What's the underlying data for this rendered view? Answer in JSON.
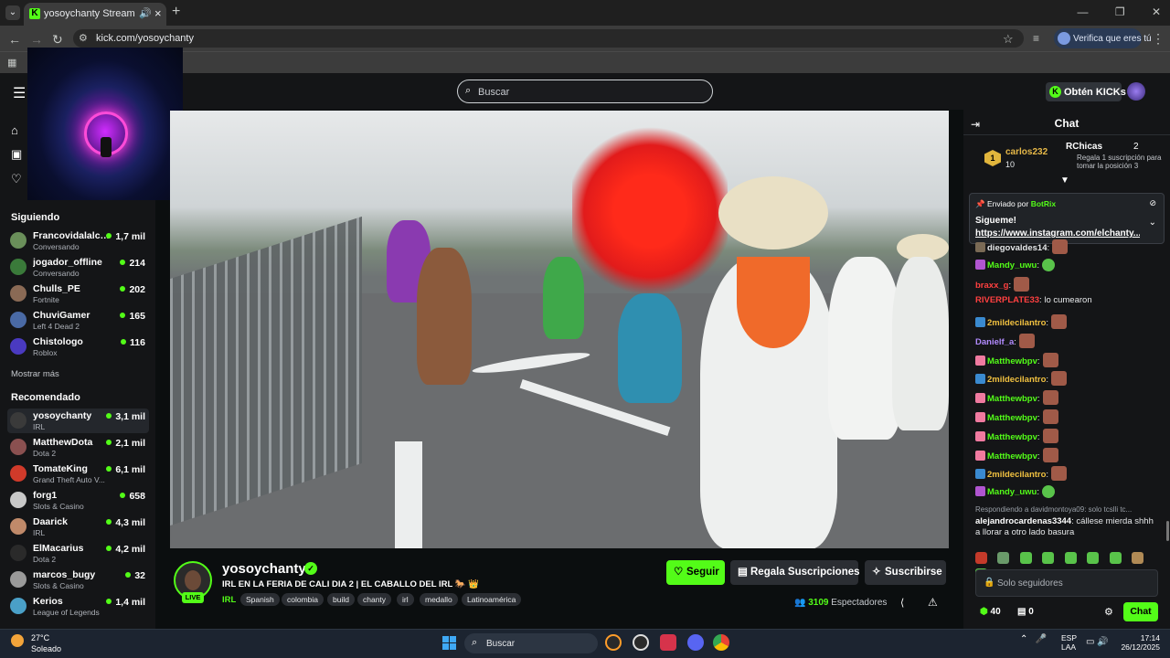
{
  "browser": {
    "tab_title": "yosoychanty Stream - Watch",
    "url": "kick.com/yosoychanty",
    "profile_label": "Verifica que eres tú"
  },
  "header": {
    "search_placeholder": "Buscar",
    "kicks_label": "Obtén KICKs"
  },
  "sidebar": {
    "following_title": "Siguiendo",
    "following": [
      {
        "name": "Francovidalalcal...",
        "category": "Conversando",
        "viewers": "1,7 mil"
      },
      {
        "name": "jogador_offline",
        "category": "Conversando",
        "viewers": "214"
      },
      {
        "name": "Chulls_PE",
        "category": "Fortnite",
        "viewers": "202"
      },
      {
        "name": "ChuviGamer",
        "category": "Left 4 Dead 2",
        "viewers": "165"
      },
      {
        "name": "Chistologo",
        "category": "Roblox",
        "viewers": "116"
      }
    ],
    "show_more": "Mostrar más",
    "recommended_title": "Recomendado",
    "recommended": [
      {
        "name": "yosoychanty",
        "category": "IRL",
        "viewers": "3,1 mil"
      },
      {
        "name": "MatthewDota",
        "category": "Dota 2",
        "viewers": "2,1 mil"
      },
      {
        "name": "TomateKing",
        "category": "Grand Theft Auto V...",
        "viewers": "6,1 mil"
      },
      {
        "name": "forg1",
        "category": "Slots & Casino",
        "viewers": "658"
      },
      {
        "name": "Daarick",
        "category": "IRL",
        "viewers": "4,3 mil"
      },
      {
        "name": "ElMacarius",
        "category": "Dota 2",
        "viewers": "4,2 mil"
      },
      {
        "name": "marcos_bugy",
        "category": "Slots & Casino",
        "viewers": "32"
      },
      {
        "name": "Kerios",
        "category": "League of Legends",
        "viewers": "1,4 mil"
      }
    ]
  },
  "stream": {
    "channel": "yosoychanty",
    "live_badge": "LIVE",
    "title": "IRL EN LA FERIA DE CALI DIA 2 | EL CABALLO DEL IRL 🐎 👑",
    "category": "IRL",
    "tags": [
      "Spanish",
      "colombia",
      "build",
      "chanty",
      "irl",
      "medallo",
      "Latinoamérica"
    ],
    "follow_label": "Seguir",
    "gift_label": "Regala Suscripciones",
    "subscribe_label": "Suscribirse",
    "viewer_count": "3109",
    "viewer_label": "Espectadores"
  },
  "chat": {
    "title": "Chat",
    "leaderboard": {
      "rank": "1",
      "top_user": "carlos232",
      "top_count": "10",
      "second_user": "RChicas",
      "second_count": "2",
      "second_desc": "Regala 1 suscripción para tomar la posición 3"
    },
    "pinned": {
      "sent_by": "Enviado por",
      "bot": "BotRix",
      "line1": "Sigueme!",
      "line2": "https://www.instagram.com/elchanty..."
    },
    "messages": [
      {
        "user": "diegovaldes14",
        "text": "",
        "color": "#e6e8ea"
      },
      {
        "user": "Mandy_uwu",
        "text": "",
        "color": "#53fc18"
      },
      {
        "user": "braxx_g",
        "text": "",
        "color": "#ff4040"
      },
      {
        "user": "RIVERPLATE33",
        "text": "lo cumearon",
        "color": "#ff4040"
      },
      {
        "user": "2mildecilantro",
        "text": "",
        "color": "#f0c040"
      },
      {
        "user": "Danielf_a",
        "text": "",
        "color": "#b28bff"
      },
      {
        "user": "Matthewbpv",
        "text": "",
        "color": "#53fc18"
      },
      {
        "user": "2mildecilantro",
        "text": "",
        "color": "#f0c040"
      },
      {
        "user": "Matthewbpv",
        "text": "",
        "color": "#53fc18"
      },
      {
        "user": "Matthewbpv",
        "text": "",
        "color": "#53fc18"
      },
      {
        "user": "Matthewbpv",
        "text": "",
        "color": "#53fc18"
      },
      {
        "user": "Matthewbpv",
        "text": "",
        "color": "#53fc18"
      },
      {
        "user": "2mildecilantro",
        "text": "",
        "color": "#f0c040"
      },
      {
        "user": "Mandy_uwu",
        "text": "",
        "color": "#53fc18"
      }
    ],
    "reply_to": "Respondiendo a davidmontoya09: solo tcslli tc...",
    "last_user": "alejandrocardenas3344",
    "last_text": "cállese mierda shhh a llorar a otro lado basura",
    "input_placeholder": "Solo seguidores",
    "kicks": "40",
    "gifts": "0",
    "send_label": "Chat"
  },
  "taskbar": {
    "temperature": "27°C",
    "condition": "Soleado",
    "search_label": "Buscar",
    "lang1": "ESP",
    "lang2": "LAA",
    "time": "17:14",
    "date": "26/12/2025"
  },
  "colors": {
    "accent": "#53fc18",
    "background": "#0b0e0f",
    "panel": "#141517"
  }
}
